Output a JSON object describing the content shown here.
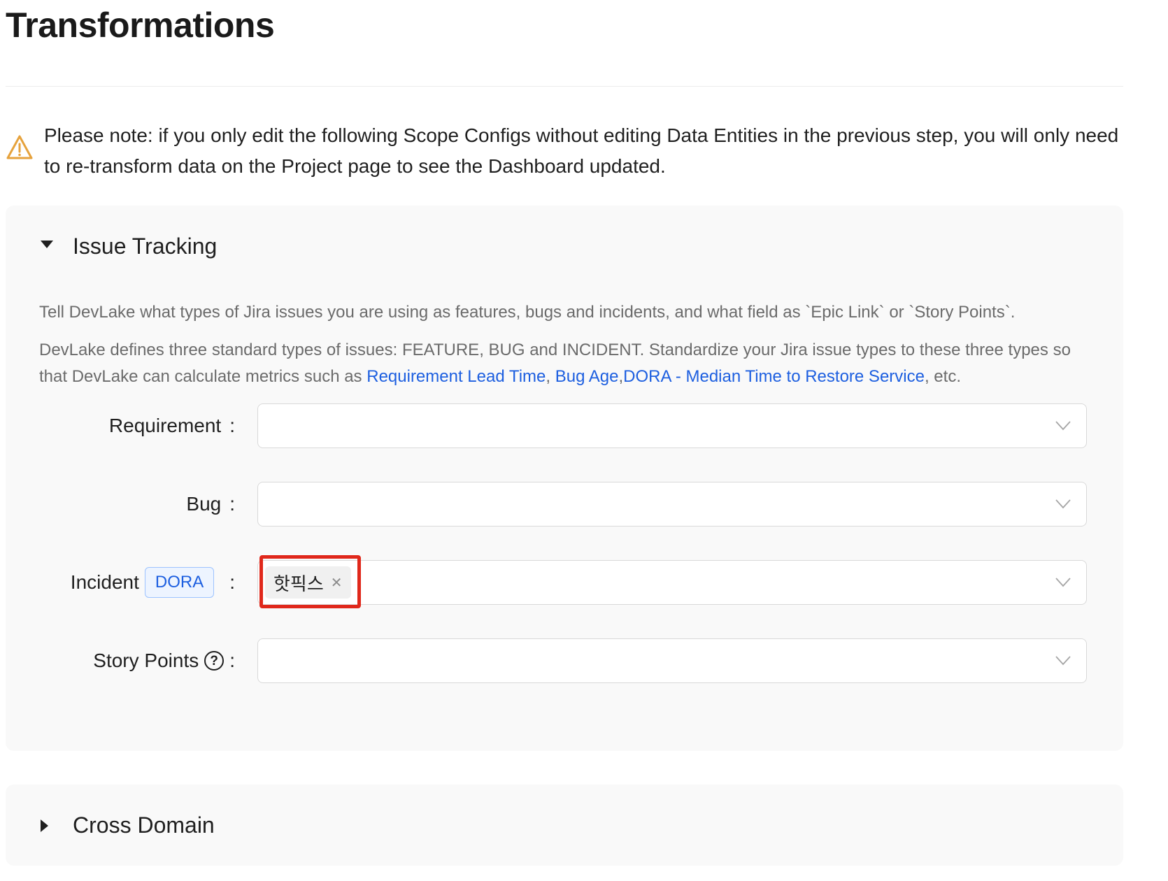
{
  "page": {
    "title": "Transformations"
  },
  "note": {
    "icon": "warning-icon",
    "icon_color": "#e6a23c",
    "text": "Please note: if you only edit the following Scope Configs without editing Data Entities in the previous step, you will only need to re-transform data on the Project page to see the Dashboard updated."
  },
  "issue_tracking": {
    "title": "Issue Tracking",
    "expanded": true,
    "description_1": "Tell DevLake what types of Jira issues you are using as features, bugs and incidents, and what field as `Epic Link` or `Story Points`.",
    "description_2_prefix": "DevLake defines three standard types of issues: FEATURE, BUG and INCIDENT. Standardize your Jira issue types to these three types so that DevLake can calculate metrics such as ",
    "links": {
      "requirement_lead_time": "Requirement Lead Time",
      "sep1": ", ",
      "bug_age": "Bug Age",
      "sep2": ",",
      "dora_mttr": "DORA - Median Time to Restore Service"
    },
    "description_2_suffix": ", etc.",
    "link_color": "#1d5fe0",
    "fields": {
      "requirement": {
        "label": "Requirement",
        "colon": ":"
      },
      "bug": {
        "label": "Bug",
        "colon": ":"
      },
      "incident": {
        "label": "Incident",
        "tag": "DORA",
        "colon": ":",
        "selected_values": [
          "핫픽스"
        ]
      },
      "story_points": {
        "label": "Story Points",
        "help_icon": "question-circle-icon",
        "colon": ":"
      }
    }
  },
  "cross_domain": {
    "title": "Cross Domain",
    "expanded": false
  },
  "highlight_color": "#e0281b"
}
